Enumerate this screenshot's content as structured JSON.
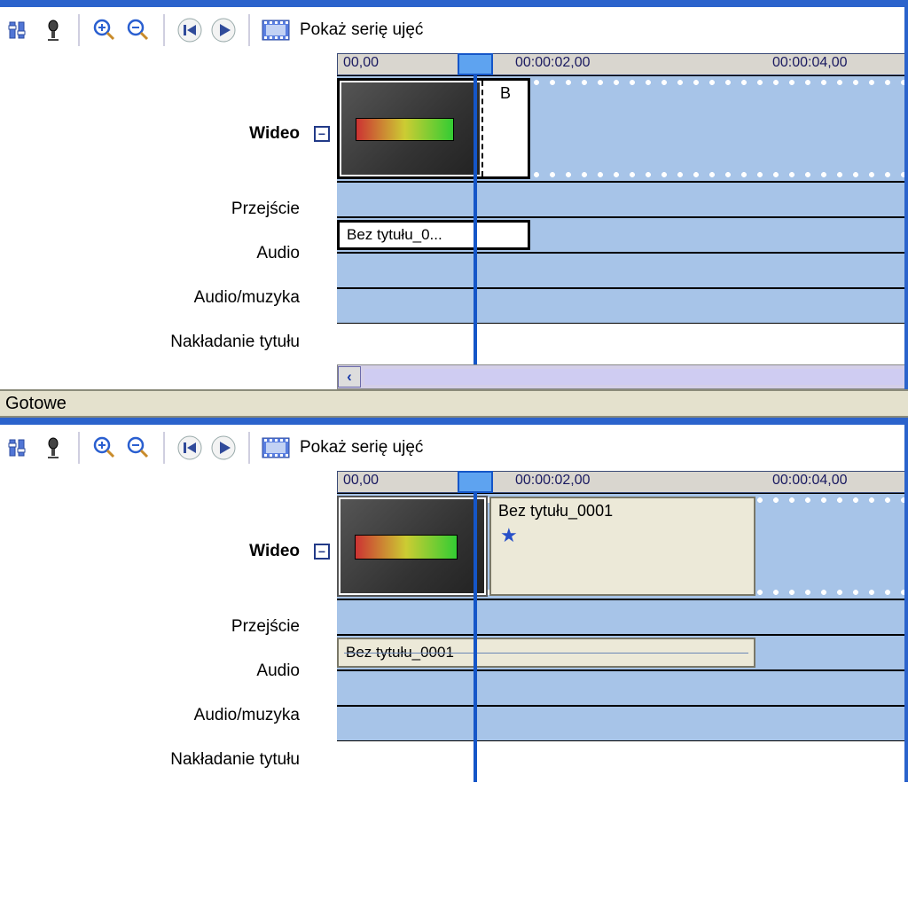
{
  "toolbar": {
    "show_storyboard": "Pokaż serię ujęć"
  },
  "ruler": {
    "t0": "00,00",
    "t1": "00:00:02,00",
    "t2": "00:00:04,00"
  },
  "tracks": {
    "video": "Wideo",
    "transition": "Przejście",
    "audio": "Audio",
    "audiomusic": "Audio/muzyka",
    "titleoverlay": "Nakładanie tytułu"
  },
  "clips": {
    "video_short_label": "B",
    "clip_name": "Bez tytułu_0001",
    "audio_truncated": "Bez tytułu_0..."
  },
  "status": "Gotowe",
  "icons": {
    "levels": "levels-icon",
    "mic": "microphone-icon",
    "zoomin": "zoom-in-icon",
    "zoomout": "zoom-out-icon",
    "rewind": "rewind-icon",
    "play": "play-icon",
    "film": "film-icon",
    "star": "star-icon"
  },
  "collapse_symbol": "−"
}
